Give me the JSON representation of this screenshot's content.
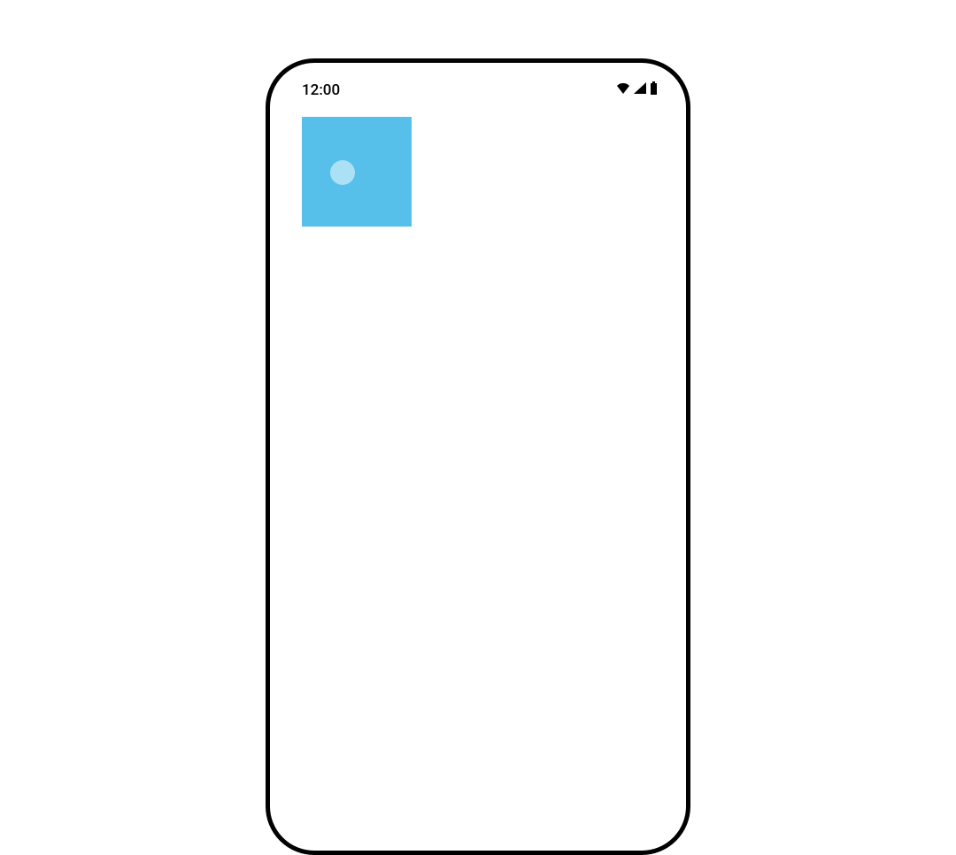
{
  "status_bar": {
    "time": "12:00"
  },
  "colors": {
    "box_background": "#56c0eb",
    "ripple": "rgba(255,255,255,0.5)",
    "frame": "#000000"
  }
}
